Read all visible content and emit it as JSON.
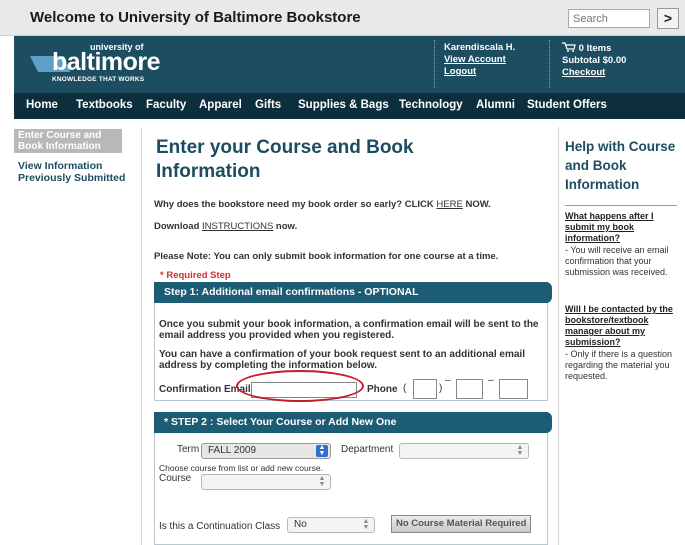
{
  "topbar": {
    "welcome": "Welcome to University of Baltimore Bookstore",
    "search_placeholder": "Search",
    "go_glyph": ">"
  },
  "header": {
    "logo_small": "university of",
    "logo_word": "baltimore",
    "logo_tagline": "KNOWLEDGE THAT WORKS",
    "user_name": "Karendiscala H.",
    "view_account": "View Account",
    "logout": "Logout",
    "cart_items": "0 Items",
    "cart_subtotal": "Subtotal $0.00",
    "checkout": "Checkout"
  },
  "nav": [
    "Home",
    "Textbooks",
    "Faculty",
    "Apparel",
    "Gifts",
    "Supplies & Bags",
    "Technology",
    "Alumni",
    "Student Offers"
  ],
  "leftnav": {
    "active": "Enter Course and Book Information",
    "item": "View Information Previously Submitted"
  },
  "main": {
    "title": "Enter your Course and Book Information",
    "why_text": "Why does the bookstore need my book order so early? CLICK",
    "why_link": "HERE",
    "why_after": "NOW.",
    "download_text": "Download",
    "download_link": "INSTRUCTIONS",
    "download_after": "now.",
    "note": "Please Note: You can only submit book information for one course at a time.",
    "required": "* Required Step",
    "step1": "Step 1: Additional email confirmations - OPTIONAL",
    "step1_p1": "Once you submit your book information, a confirmation email will be sent to the email address you provided when you registered.",
    "step1_p2": "You can have a confirmation of your book request sent to an additional email address by completing the information below.",
    "confirm_email_label": "Confirmation Email",
    "phone_label": "Phone",
    "phone_open": "(",
    "phone_close": ")",
    "dash": "–",
    "step2": "* STEP 2 : Select Your Course or Add New One",
    "term_label": "Term",
    "term_value": "FALL 2009",
    "department_label": "Department",
    "course_hint": "Choose course from list or add new course.",
    "course_label": "Course",
    "continuation_label": "Is this a Continuation Class",
    "continuation_value": "No",
    "no_material_button": "No Course Material Required"
  },
  "help": {
    "title": "Help with Course and Book Information",
    "q1": "What happens after I submit my book information?",
    "a1": "- You will receive an email confirmation that your submission was received.",
    "q2": "Will I be contacted by the bookstore/textbook manager about my submission?",
    "a2": "- Only if there is a question regarding the material you requested."
  },
  "colors": {
    "brand_dark": "#1c4d60",
    "nav_bg": "#0d2f3d",
    "required_red": "#d42c2c",
    "annotation_red": "#c01f2a"
  }
}
